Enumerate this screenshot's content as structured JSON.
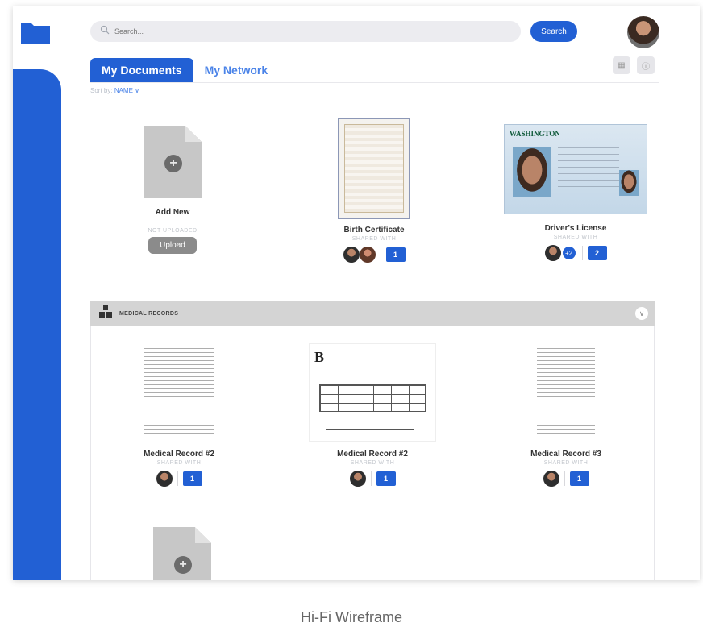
{
  "search": {
    "placeholder": "Search...",
    "button": "Search"
  },
  "tabs": [
    {
      "label": "My Documents",
      "active": true
    },
    {
      "label": "My Network",
      "active": false
    }
  ],
  "sort": {
    "prefix": "Sort by:",
    "value": "NAME ∨"
  },
  "documents": [
    {
      "title": "Add New",
      "subtitle": "NOT UPLOADED",
      "action": "Upload"
    },
    {
      "title": "Birth Certificate",
      "subtitle": "SHARED WITH",
      "folder_count": "1"
    },
    {
      "title": "Driver's License",
      "subtitle": "SHARED WITH",
      "extra_count": "+2",
      "folder_count": "2",
      "card_heading": "WASHINGTON"
    }
  ],
  "section": {
    "title": "MEDICAL RECORDS"
  },
  "medical": [
    {
      "title": "Medical Record #2",
      "subtitle": "SHARED WITH",
      "folder_count": "1"
    },
    {
      "title": "Medical Record #2",
      "subtitle": "SHARED WITH",
      "folder_count": "1",
      "mark": "B"
    },
    {
      "title": "Medical Record #3",
      "subtitle": "SHARED WITH",
      "folder_count": "1"
    }
  ],
  "caption": "Hi-Fi Wireframe",
  "colors": {
    "primary": "#2260d4",
    "tab_inactive": "#4a83e8",
    "placeholder": "#c7c7c7"
  }
}
